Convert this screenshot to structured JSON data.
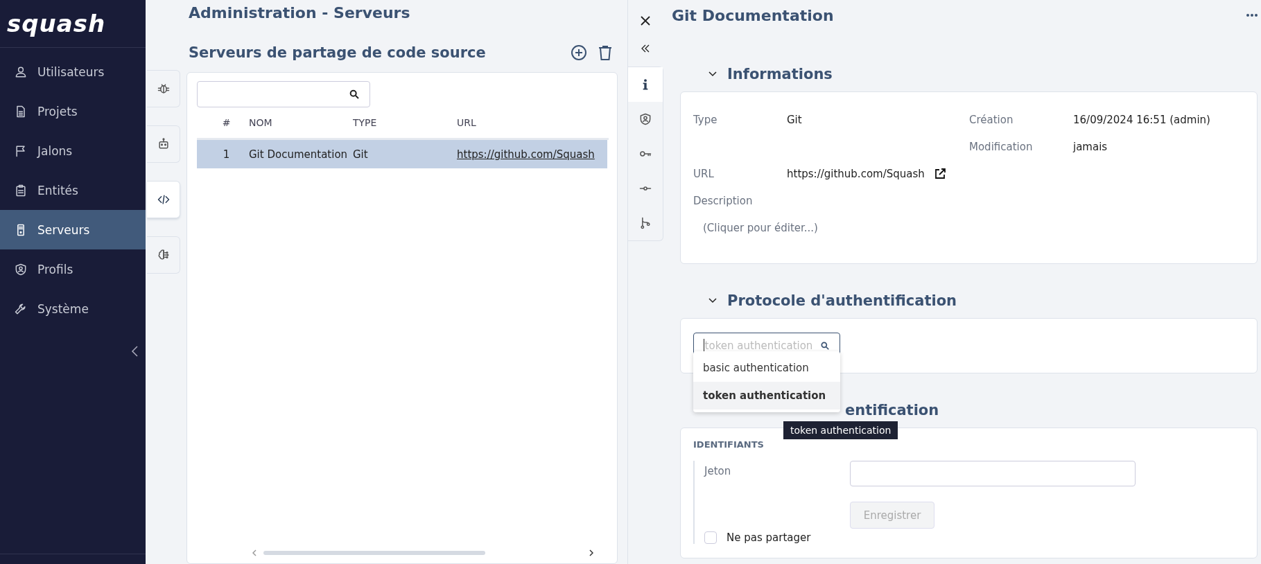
{
  "sidebar": {
    "logo": "squash",
    "items": [
      {
        "label": "Utilisateurs",
        "selected": false
      },
      {
        "label": "Projets",
        "selected": false
      },
      {
        "label": "Jalons",
        "selected": false
      },
      {
        "label": "Entités",
        "selected": false
      },
      {
        "label": "Serveurs",
        "selected": true
      },
      {
        "label": "Profils",
        "selected": false
      },
      {
        "label": "Système",
        "selected": false
      }
    ]
  },
  "side_tabs": [
    {
      "selected": false
    },
    {
      "selected": false
    },
    {
      "selected": true
    },
    {
      "selected": false
    }
  ],
  "page_title": "Administration - Serveurs",
  "list": {
    "title": "Serveurs de partage de code source",
    "table": {
      "columns": [
        "#",
        "NOM",
        "TYPE",
        "URL"
      ],
      "rows": [
        {
          "cells": [
            "1",
            "Git Documentation",
            "Git",
            "https://github.com/Squash"
          ],
          "selected": true
        }
      ]
    }
  },
  "detail": {
    "title": "Git Documentation",
    "tabs": [
      {
        "selected": true
      },
      {
        "selected": false
      },
      {
        "selected": false
      },
      {
        "selected": false
      },
      {
        "selected": false
      }
    ],
    "informations": {
      "title": "Informations",
      "left": [
        {
          "label": "Type",
          "value": "Git"
        }
      ],
      "right": [
        {
          "label": "Création",
          "value": "16/09/2024 16:51 (admin)"
        },
        {
          "label": "Modification",
          "value": "jamais"
        }
      ],
      "url_label": "URL",
      "url": "https://github.com/Squash",
      "description_label": "Description",
      "description_placeholder": "(Cliquer pour éditer...)"
    },
    "protocol": {
      "title": "Protocole d'authentification",
      "placeholder": "token authentication",
      "options": [
        {
          "label": "basic authentication",
          "selected": false
        },
        {
          "label": "token authentication",
          "selected": true
        }
      ],
      "tooltip": "token authentication"
    },
    "credentials": {
      "title": "entification",
      "group": "IDENTIFIANTS",
      "field_label": "Jeton",
      "save": "Enregistrer",
      "save_disabled": true,
      "checkbox_label": "Ne pas partager",
      "checked": false
    }
  }
}
